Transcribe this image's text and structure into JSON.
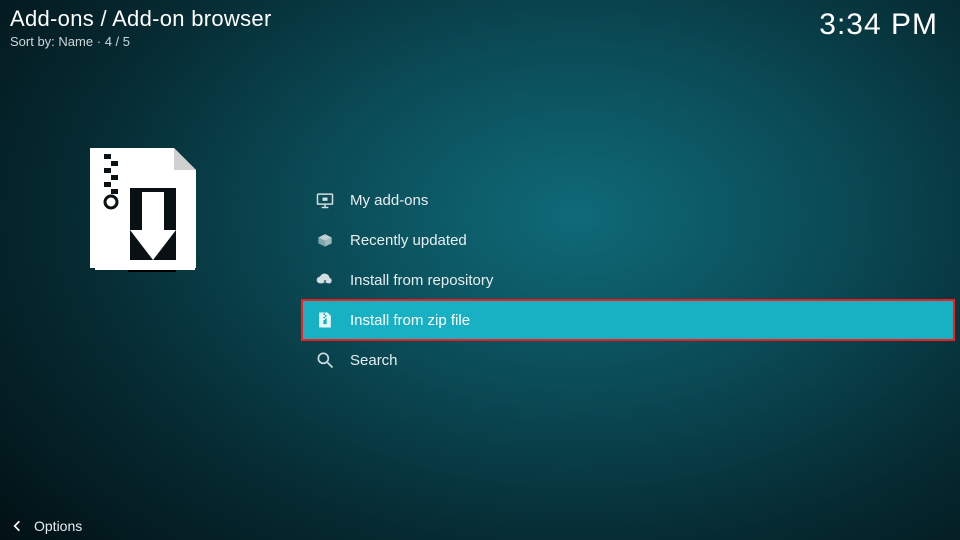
{
  "header": {
    "breadcrumb": "Add-ons / Add-on browser",
    "sort_prefix": "Sort by: ",
    "sort_value": "Name",
    "position": "4 / 5"
  },
  "clock": "3:34 PM",
  "menu": {
    "items": [
      {
        "label": "My add-ons",
        "icon": "monitor-addon-icon"
      },
      {
        "label": "Recently updated",
        "icon": "open-box-icon"
      },
      {
        "label": "Install from repository",
        "icon": "cloud-download-icon"
      },
      {
        "label": "Install from zip file",
        "icon": "zip-file-icon"
      },
      {
        "label": "Search",
        "icon": "search-icon"
      }
    ],
    "selected_index": 3
  },
  "footer": {
    "options_label": "Options"
  },
  "colors": {
    "highlight": "#18b1c4",
    "highlight_outline": "#ff1a1a"
  }
}
